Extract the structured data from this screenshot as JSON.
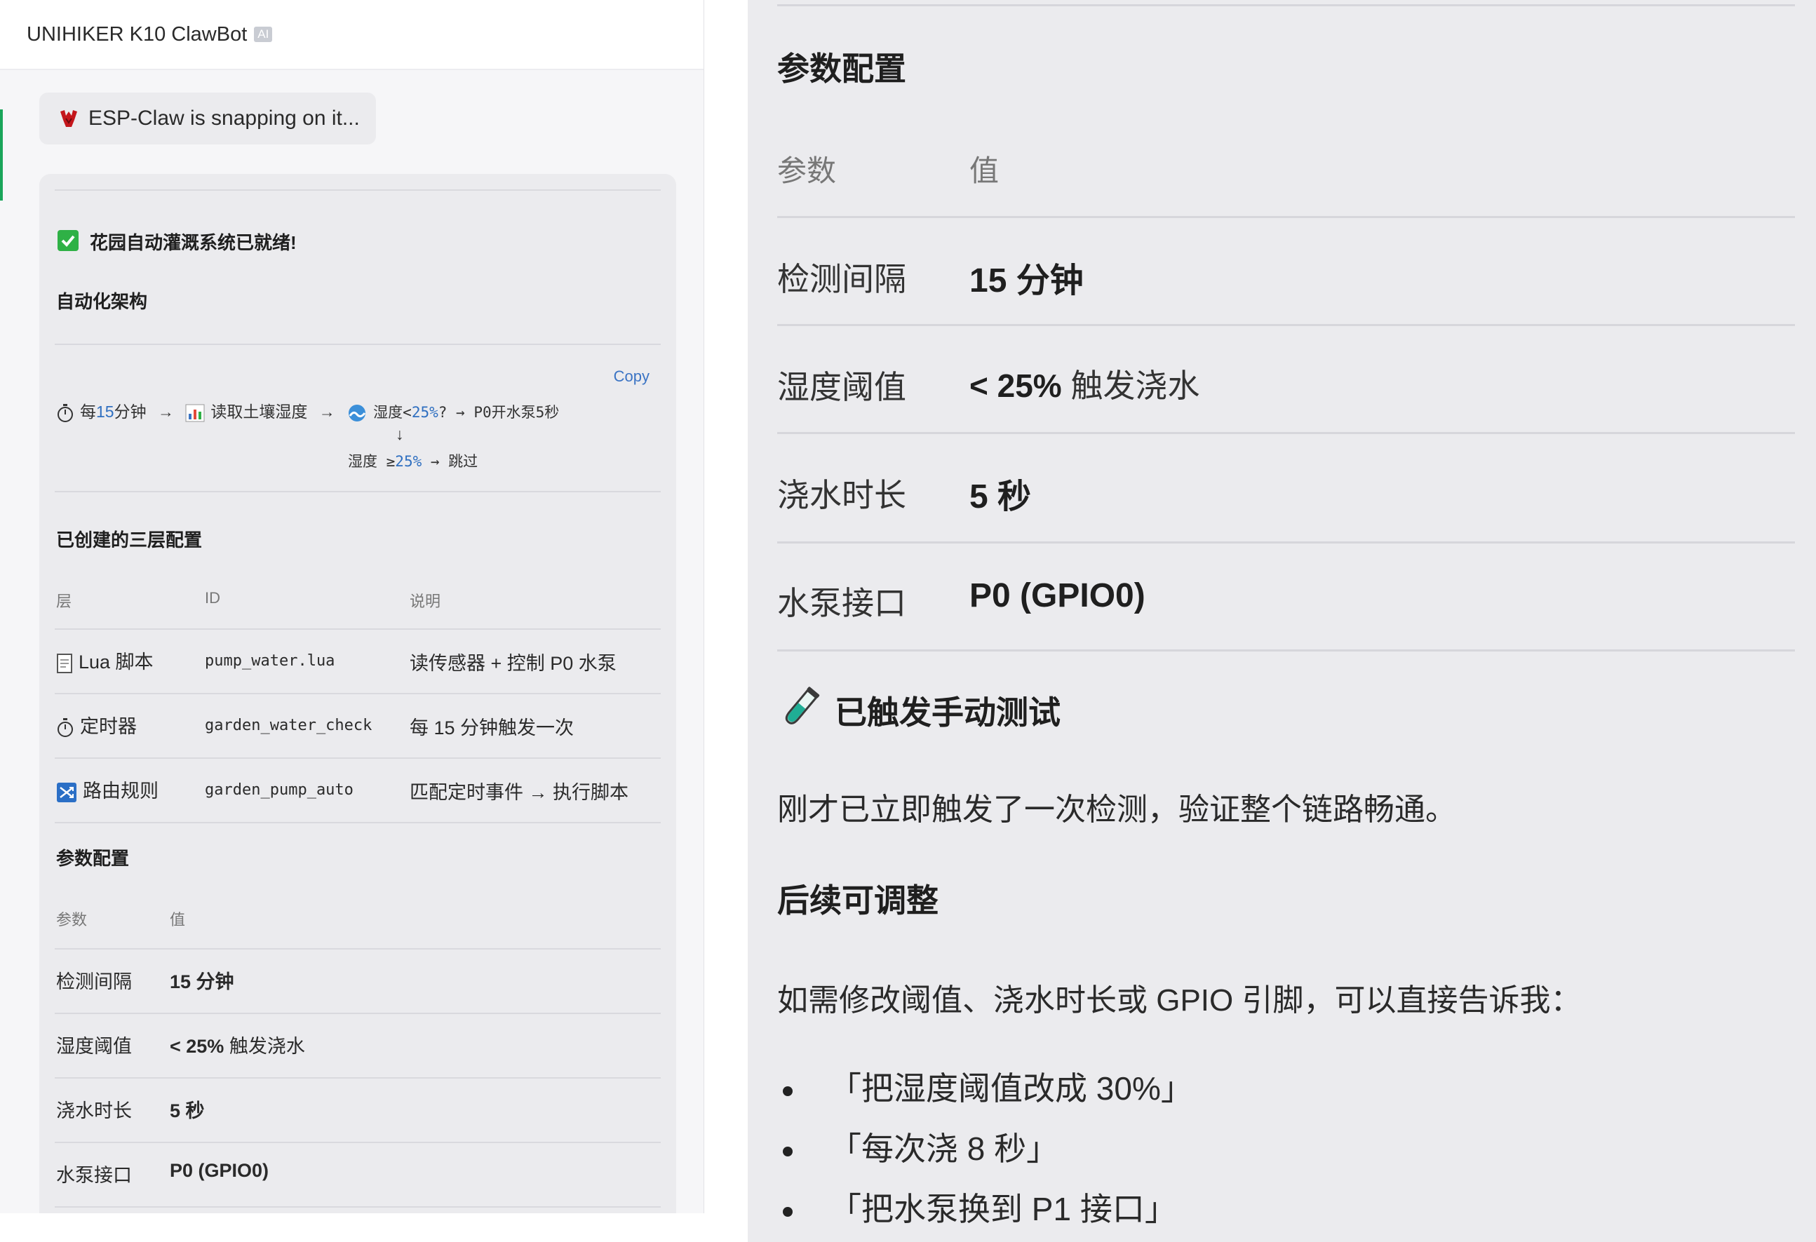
{
  "app": {
    "title": "UNIHIKER K10 ClawBot",
    "badge": "AI",
    "status": "ESP-Claw is snapping on it..."
  },
  "colors": {
    "accent": "#1aa55a",
    "check": "#2fb146",
    "link": "#3b74c4",
    "number": "#2f6fc0"
  },
  "message": {
    "ready": "花园自动灌溉系统已就绪!",
    "arch_title": "自动化架构",
    "copy_label": "Copy",
    "flow": {
      "timer_prefix": "每",
      "timer_num": "15",
      "timer_suffix": "分钟",
      "arrow": "→",
      "read": "读取土壤湿度",
      "humid_prefix": "湿度<",
      "humid_num": "25%",
      "humid_suffix": "? → P0开水泵5秒",
      "down_arrow": "↓",
      "else_prefix": "湿度 ≥",
      "else_num": "25%",
      "else_suffix": " → 跳过"
    },
    "layers_title": "已创建的三层配置",
    "layers_table": {
      "headers": [
        "层",
        "ID",
        "说明"
      ],
      "rows": [
        {
          "layer": "Lua 脚本",
          "id": "pump_water.lua",
          "desc": "读传感器 + 控制 P0 水泵",
          "icon": "document-icon"
        },
        {
          "layer": "定时器",
          "id": "garden_water_check",
          "desc": "每 15 分钟触发一次",
          "icon": "stopwatch-icon"
        },
        {
          "layer": "路由规则",
          "id": "garden_pump_auto",
          "desc": "匹配定时事件 → 执行脚本",
          "icon": "shuffle-icon"
        }
      ]
    },
    "params_title": "参数配置",
    "params_table": {
      "headers": [
        "参数",
        "值"
      ],
      "rows": [
        {
          "name": "检测间隔",
          "value": "15 分钟"
        },
        {
          "name": "湿度阈值",
          "value_bold": "< 25%",
          "value_rest": " 触发浇水"
        },
        {
          "name": "浇水时长",
          "value": "5 秒"
        },
        {
          "name": "水泵接口",
          "value": "P0 (GPIO0)"
        }
      ]
    }
  },
  "zoom": {
    "params_title": "参数配置",
    "headers": [
      "参数",
      "值"
    ],
    "rows": [
      {
        "name": "检测间隔",
        "value": "15 分钟"
      },
      {
        "name": "湿度阈值",
        "value_bold": "< 25%",
        "value_rest": " 触发浇水"
      },
      {
        "name": "浇水时长",
        "value": "5 秒"
      },
      {
        "name": "水泵接口",
        "value": "P0 (GPIO0)"
      }
    ],
    "test_title": "已触发手动测试",
    "test_text": "刚才已立即触发了一次检测，验证整个链路畅通。",
    "adjust_title": "后续可调整",
    "adjust_text": "如需修改阈值、浇水时长或 GPIO 引脚，可以直接告诉我：",
    "bullets": [
      "「把湿度阈值改成 30%」",
      "「每次浇 8 秒」",
      "「把水泵换到 P1 接口」"
    ]
  }
}
